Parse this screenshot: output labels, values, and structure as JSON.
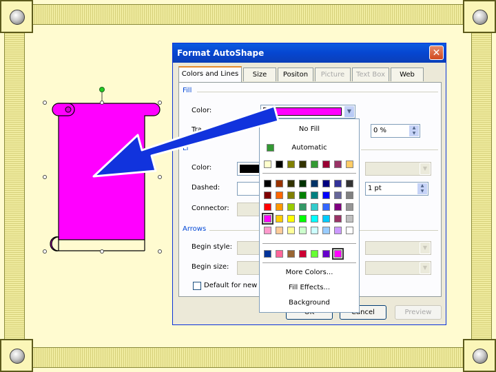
{
  "dialog": {
    "title": "Format AutoShape",
    "close_glyph": "✕",
    "tabs": [
      {
        "label": "Colors and Lines"
      },
      {
        "label": "Size"
      },
      {
        "label": "Positon"
      },
      {
        "label": "Picture"
      },
      {
        "label": "Text Box"
      },
      {
        "label": "Web"
      }
    ],
    "fill_section": "Fill",
    "fill_color_label": "Color:",
    "fill_color_value": "#ff00ff",
    "transparency_label": "Tra",
    "transparency_value": "0 %",
    "line_section_fragment": "Li",
    "line_color_label": "Color:",
    "dashed_label": "Dashed:",
    "weight_value": "1 pt",
    "connector_label": "Connector:",
    "arrows_section": "Arrows",
    "begin_style_label": "Begin style:",
    "begin_size_label": "Begin size:",
    "default_label": "Default for new ob",
    "ok_label": "OK",
    "cancel_label": "Cancel",
    "preview_label": "Preview"
  },
  "color_popup": {
    "no_fill": "No Fill",
    "automatic": "Automatic",
    "automatic_color": "#339933",
    "more_colors": "More Colors...",
    "fill_effects": "Fill Effects...",
    "background": "Background",
    "scheme_colors": [
      "#ffffcc",
      "#000000",
      "#808000",
      "#333300",
      "#339933",
      "#990033",
      "#993366",
      "#ffcc66"
    ],
    "standard_colors": [
      [
        "#000000",
        "#993300",
        "#333300",
        "#003300",
        "#003366",
        "#000080",
        "#333399",
        "#333333"
      ],
      [
        "#800000",
        "#ff6600",
        "#808000",
        "#008000",
        "#008080",
        "#0000ff",
        "#666699",
        "#808080"
      ],
      [
        "#ff0000",
        "#ff9900",
        "#99cc00",
        "#339966",
        "#33cccc",
        "#3366ff",
        "#800080",
        "#969696"
      ],
      [
        "#ff00ff",
        "#ffcc00",
        "#ffff00",
        "#00ff00",
        "#00ffff",
        "#00ccff",
        "#993366",
        "#c0c0c0"
      ],
      [
        "#ff99cc",
        "#ffcc99",
        "#ffff99",
        "#ccffcc",
        "#ccffff",
        "#99ccff",
        "#cc99ff",
        "#ffffff"
      ]
    ],
    "recent_colors": [
      "#003399",
      "#ff6699",
      "#996633",
      "#cc0033",
      "#66ff33",
      "#6600cc",
      "#ff00ff"
    ],
    "selected_color": "#ff00ff"
  },
  "scroll_shape": {
    "fill": "#ff00ff",
    "outline": "#000000"
  },
  "arrow": {
    "fill": "#1133dd",
    "outline": "#ffffff"
  },
  "frame": {
    "background": "#fffbd0",
    "border": "#5c5a1c"
  }
}
